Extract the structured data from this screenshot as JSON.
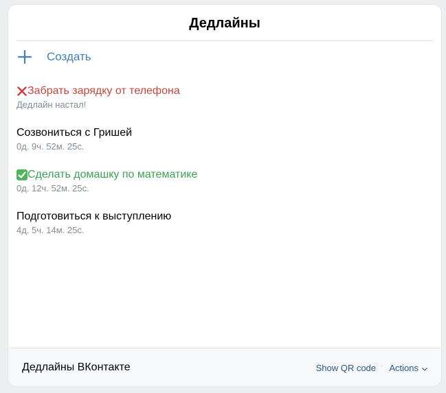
{
  "header": {
    "title": "Дедлайны"
  },
  "create": {
    "label": "Создать",
    "icon": "plus-icon"
  },
  "deadlines": [
    {
      "title": "Забрать зарядку от телефона",
      "subtitle": "Дедлайн настал!",
      "status": "expired",
      "icon": "cross-mark-icon"
    },
    {
      "title": "Созвониться с Гришей",
      "subtitle": "0д. 9ч. 52м. 25с.",
      "status": "pending"
    },
    {
      "title": "Сделать домашку по математике",
      "subtitle": "0д. 12ч. 52м. 25с.",
      "status": "done",
      "icon": "check-mark-icon"
    },
    {
      "title": "Подготовиться к выступлению",
      "subtitle": "4д. 5ч. 14м. 25с.",
      "status": "pending"
    }
  ],
  "footer": {
    "app_name": "Дедлайны ВКонтакте",
    "qr_label": "Show QR code",
    "separator": "·",
    "actions_label": "Actions"
  },
  "colors": {
    "accent": "#3f7fc4",
    "expired": "#c8453b",
    "done": "#3aa251",
    "muted": "#818c99",
    "footer_link": "#2a5885"
  }
}
